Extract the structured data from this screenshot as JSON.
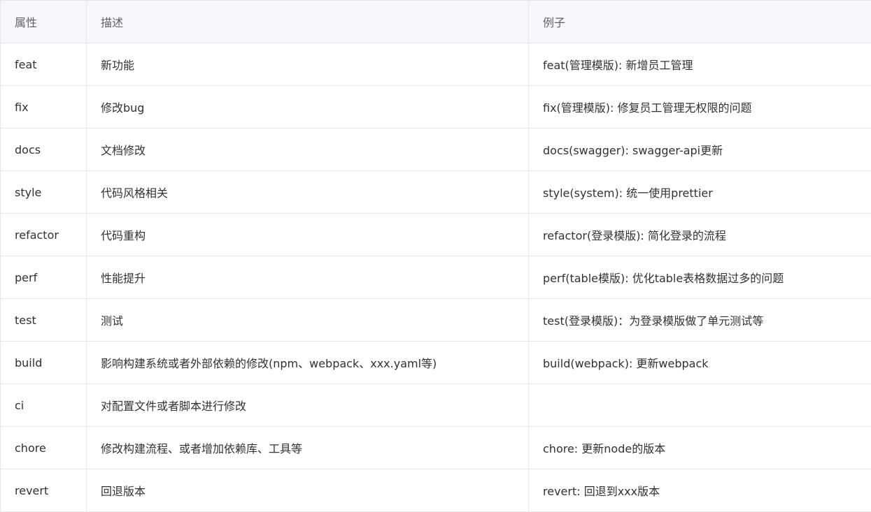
{
  "table": {
    "headers": [
      "属性",
      "描述",
      "例子"
    ],
    "rows": [
      {
        "attr": "feat",
        "desc": "新功能",
        "example": "feat(管理模版): 新增员工管理"
      },
      {
        "attr": "fix",
        "desc": "修改bug",
        "example": "fix(管理模版): 修复员工管理无权限的问题"
      },
      {
        "attr": "docs",
        "desc": "文档修改",
        "example": "docs(swagger): swagger-api更新"
      },
      {
        "attr": "style",
        "desc": "代码风格相关",
        "example": "style(system): 统一使用prettier"
      },
      {
        "attr": "refactor",
        "desc": "代码重构",
        "example": "refactor(登录模版): 简化登录的流程"
      },
      {
        "attr": "perf",
        "desc": "性能提升",
        "example": "perf(table模版): 优化table表格数据过多的问题"
      },
      {
        "attr": "test",
        "desc": "测试",
        "example": "test(登录模版)：为登录模版做了单元测试等"
      },
      {
        "attr": "build",
        "desc": "影响构建系统或者外部依赖的修改(npm、webpack、xxx.yaml等)",
        "example": "build(webpack): 更新webpack"
      },
      {
        "attr": "ci",
        "desc": "对配置文件或者脚本进行修改",
        "example": ""
      },
      {
        "attr": "chore",
        "desc": "修改构建流程、或者增加依赖库、工具等",
        "example": "chore: 更新node的版本"
      },
      {
        "attr": "revert",
        "desc": "回退版本",
        "example": "revert: 回退到xxx版本"
      }
    ]
  },
  "colors": {
    "header_bg": "#f5f7fa",
    "header_text": "#606266",
    "body_text": "#303133",
    "border": "#e5e7eb"
  }
}
